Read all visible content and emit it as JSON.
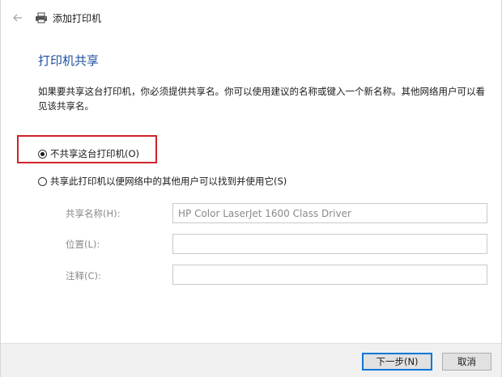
{
  "window": {
    "title": "添加打印机"
  },
  "page": {
    "heading": "打印机共享",
    "description": "如果要共享这台打印机，你必须提供共享名。你可以使用建议的名称或键入一个新名称。其他网络用户可以看见该共享名。"
  },
  "options": {
    "no_share": {
      "label": "不共享这台打印机(O)",
      "selected": true
    },
    "share": {
      "label": "共享此打印机以便网络中的其他用户可以找到并使用它(S)",
      "selected": false
    }
  },
  "fields": {
    "share_name": {
      "label": "共享名称(H):",
      "value": "HP Color LaserJet 1600 Class Driver"
    },
    "location": {
      "label": "位置(L):",
      "value": ""
    },
    "comment": {
      "label": "注释(C):",
      "value": ""
    }
  },
  "buttons": {
    "next": "下一步(N)",
    "cancel": "取消"
  },
  "colors": {
    "heading": "#1f4f9e",
    "highlight": "#d0232a",
    "default_button_border": "#0078d7"
  },
  "icons": {
    "back": "back-arrow-icon",
    "printer": "printer-icon"
  }
}
